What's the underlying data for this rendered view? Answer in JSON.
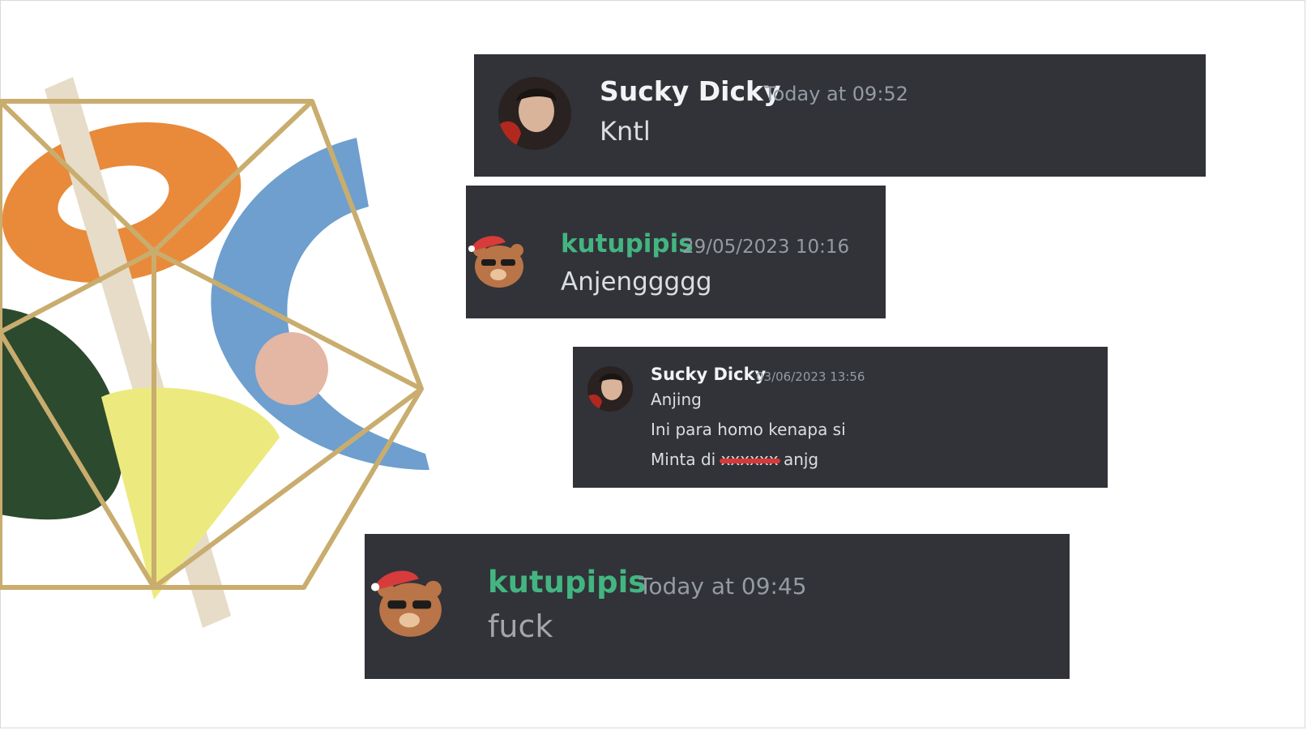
{
  "colors": {
    "card_bg": "#313338",
    "name_white": "#f2f3f5",
    "name_green": "#43b581",
    "timestamp": "#949ba4",
    "text": "#dbdee1"
  },
  "decoration": {
    "icon": "abstract-3d-shapes-illustration"
  },
  "messages": [
    {
      "avatar": "profile-photo-avatar",
      "username": "Sucky Dicky",
      "timestamp": "Today at 09:52",
      "lines": [
        "Kntl"
      ]
    },
    {
      "avatar": "bear-with-santa-hat-avatar",
      "username": "kutupipis",
      "timestamp": "29/05/2023 10:16",
      "lines": [
        "Anjenggggg"
      ]
    },
    {
      "avatar": "profile-photo-avatar",
      "username": "Sucky Dicky",
      "timestamp": "03/06/2023 13:56",
      "lines": [
        "Anjing",
        "Ini para homo kenapa si"
      ],
      "line3_prefix": "Minta di",
      "line3_suffix": "anjg"
    },
    {
      "avatar": "bear-with-santa-hat-avatar",
      "username": "kutupipis",
      "timestamp": "Today at 09:45",
      "lines": [
        "fuck"
      ]
    }
  ]
}
